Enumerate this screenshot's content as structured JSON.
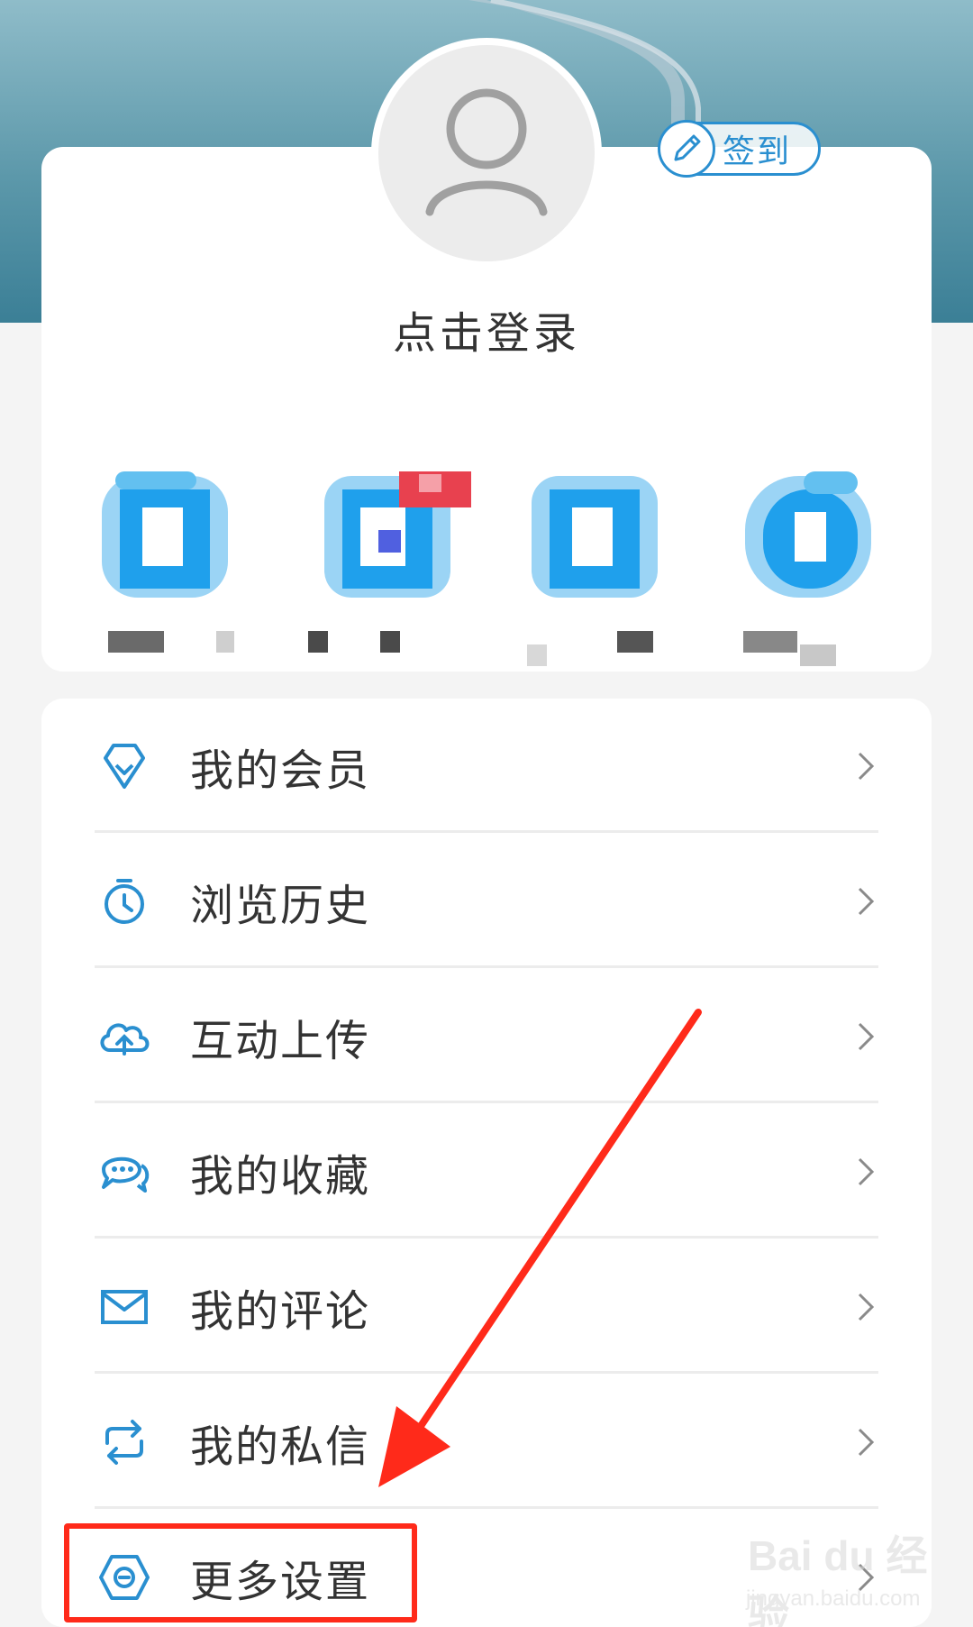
{
  "header": {
    "checkin_label": "签到",
    "login_prompt": "点击登录"
  },
  "menu": {
    "items": [
      {
        "label": "我的会员",
        "icon": "diamond-icon"
      },
      {
        "label": "浏览历史",
        "icon": "clock-icon"
      },
      {
        "label": "互动上传",
        "icon": "cloud-upload-icon"
      },
      {
        "label": "我的收藏",
        "icon": "chat-bubbles-icon"
      },
      {
        "label": "我的评论",
        "icon": "mail-icon"
      },
      {
        "label": "我的私信",
        "icon": "repeat-icon"
      },
      {
        "label": "更多设置",
        "icon": "settings-hex-icon"
      }
    ]
  },
  "colors": {
    "accent": "#2a8fd0",
    "annotation": "#ff2a1a",
    "text": "#333333",
    "header_top": "#8fbcc9",
    "header_bottom": "#3b7f96"
  },
  "watermark": {
    "main": "Bai du 经验",
    "sub": "jingyan.baidu.com"
  }
}
